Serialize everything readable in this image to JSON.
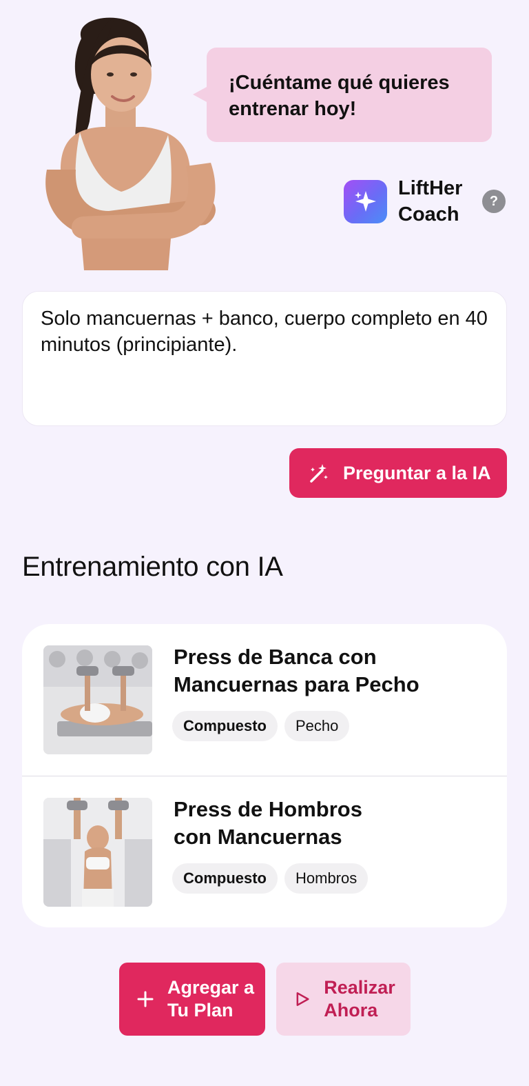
{
  "coach": {
    "bubble_text": "¡Cuéntame qué quieres entrenar hoy!",
    "brand_name": "LiftHer Coach",
    "help_label": "?"
  },
  "prompt": {
    "value": "Solo mancuernas + banco, cuerpo completo en 40 minutos (principiante)."
  },
  "ask_button_label": "Preguntar a la IA",
  "section_title": "Entrenamiento con IA",
  "exercises": [
    {
      "name": "Press de Banca con Mancuernas para Pecho",
      "tags": [
        "Compuesto",
        "Pecho"
      ]
    },
    {
      "name": "Press de Hombros con Mancuernas",
      "tags": [
        "Compuesto",
        "Hombros"
      ]
    }
  ],
  "actions": {
    "add_label": "Agregar a Tu Plan",
    "do_label": "Realizar Ahora"
  },
  "colors": {
    "background": "#f6f2fd",
    "accent": "#e0285e",
    "bubble": "#f4cfe3",
    "secondary_button": "#f6d7e8"
  },
  "icons": [
    "sparkle-icon",
    "help-icon",
    "magic-wand-icon",
    "plus-icon",
    "play-icon"
  ]
}
